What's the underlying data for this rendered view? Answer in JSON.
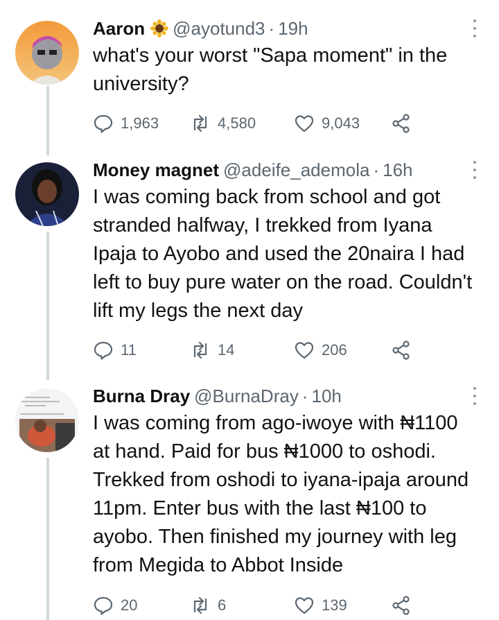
{
  "tweets": [
    {
      "name": "Aaron",
      "badge_icon": "sunflower-icon",
      "handle": "@ayotund3",
      "separator": "·",
      "time": "19h",
      "text": "what's your worst \"Sapa moment\" in the university?",
      "replies": "1,963",
      "retweets": "4,580",
      "likes": "9,043"
    },
    {
      "name": "Money magnet",
      "handle": "@adeife_ademola",
      "separator": "·",
      "time": "16h",
      "text": "I was coming back from school and got stranded halfway, I trekked from Iyana Ipaja to Ayobo and used the 20naira I had left to buy pure water on the road. Couldn't lift my legs the next day",
      "replies": "11",
      "retweets": "14",
      "likes": "206"
    },
    {
      "name": "Burna Dray",
      "handle": "@BurnaDray",
      "separator": "·",
      "time": "10h",
      "text": "I was coming from ago-iwoye with ₦1100 at hand. Paid for bus ₦1000 to oshodi. Trekked from oshodi to iyana-ipaja around 11pm. Enter bus with the last ₦100 to ayobo. Then finished my journey with leg from Megida to Abbot Inside",
      "replies": "20",
      "retweets": "6",
      "likes": "139"
    }
  ],
  "colors": {
    "text": "#111111",
    "muted": "#5b6670",
    "thread_line": "#cfd9de",
    "background": "#ffffff"
  },
  "icons": {
    "reply": "reply-icon",
    "retweet": "retweet-icon",
    "like": "heart-icon",
    "share": "share-icon",
    "more": "more-options-icon"
  }
}
